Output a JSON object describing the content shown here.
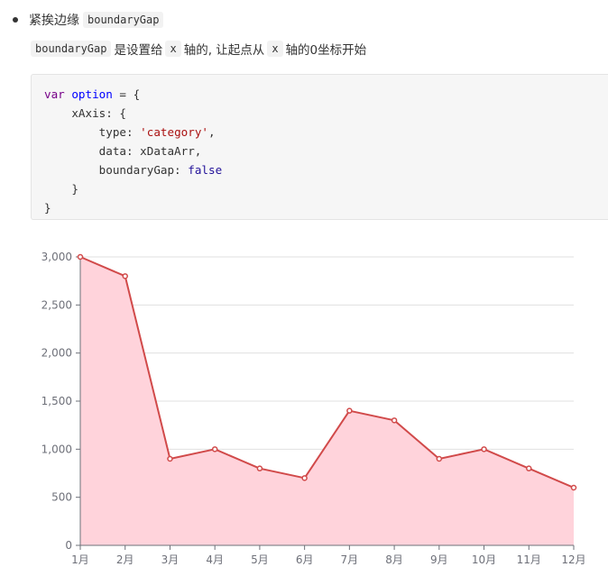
{
  "section": {
    "bullet_text": "紧挨边缘",
    "bullet_code": "boundaryGap",
    "desc_code_1": "boundaryGap",
    "desc_text_1": "是设置给",
    "desc_code_2": "x",
    "desc_text_2": "轴的, 让起点从",
    "desc_code_3": "x",
    "desc_text_3": "轴的0坐标开始"
  },
  "code": {
    "line1_kw": "var",
    "line1_var": "option",
    "line1_rest": " = {",
    "line2": "    xAxis: {",
    "line3_key": "        type: ",
    "line3_val": "'category'",
    "line3_end": ",",
    "line4": "        data: xDataArr,",
    "line5_key": "        boundaryGap: ",
    "line5_val": "false",
    "line6": "    }",
    "line7": "}"
  },
  "colors": {
    "line": "#d14a4a",
    "area": "#ffd3db",
    "axis": "#6e7079",
    "grid": "#e0e0e0"
  },
  "chart_data": {
    "type": "area",
    "categories": [
      "1月",
      "2月",
      "3月",
      "4月",
      "5月",
      "6月",
      "7月",
      "8月",
      "9月",
      "10月",
      "11月",
      "12月"
    ],
    "values": [
      3000,
      2800,
      900,
      1000,
      800,
      700,
      1400,
      1300,
      900,
      1000,
      800,
      600
    ],
    "y_ticks": [
      "0",
      "500",
      "1,000",
      "1,500",
      "2,000",
      "2,500",
      "3,000"
    ],
    "ylim": [
      0,
      3000
    ],
    "grid": true,
    "boundaryGap": false
  }
}
